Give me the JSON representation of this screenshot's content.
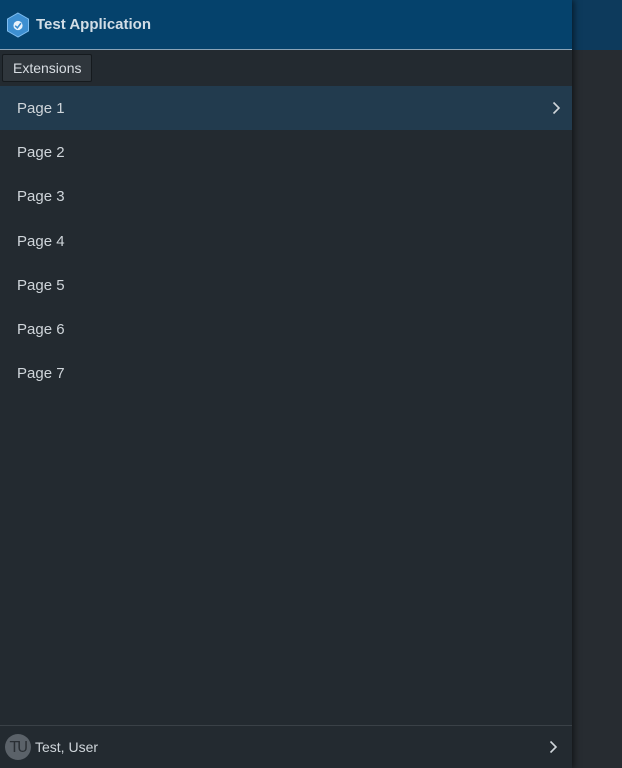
{
  "app": {
    "title": "Test Application",
    "logo_icon": "hexagon-logo-icon"
  },
  "extensions": {
    "label": "Extensions"
  },
  "nav": {
    "items": [
      {
        "label": "Page 1",
        "active": true
      },
      {
        "label": "Page 2",
        "active": false
      },
      {
        "label": "Page 3",
        "active": false
      },
      {
        "label": "Page 4",
        "active": false
      },
      {
        "label": "Page 5",
        "active": false
      },
      {
        "label": "Page 6",
        "active": false
      },
      {
        "label": "Page 7",
        "active": false
      }
    ]
  },
  "user": {
    "name": "Test, User",
    "initials": "TU"
  },
  "colors": {
    "header_bg": "#05426c",
    "drawer_bg": "#232a30",
    "active_item_bg": "#223b4e",
    "text": "#cfd5da"
  }
}
